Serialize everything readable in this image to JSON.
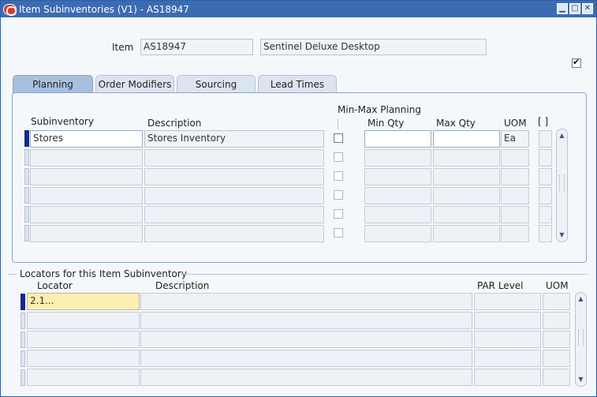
{
  "window": {
    "title": "Item Subinventories (V1) - AS18947",
    "buttons": [
      "minimize-icon",
      "maximize-icon",
      "close-icon"
    ]
  },
  "item": {
    "label": "Item",
    "value": "AS18947",
    "description": "Sentinel Deluxe Desktop",
    "checkbox_checked": true
  },
  "tabs": [
    {
      "label": "Planning",
      "active": true
    },
    {
      "label": "Order Modifiers",
      "active": false
    },
    {
      "label": "Sourcing",
      "active": false
    },
    {
      "label": "Lead Times",
      "active": false
    }
  ],
  "planning": {
    "headers": {
      "subinventory": "Subinventory",
      "description": "Description",
      "minmax_group": "Min-Max Planning",
      "min_qty": "Min Qty",
      "max_qty": "Max Qty",
      "uom": "UOM",
      "flex": "[ ]"
    },
    "rows": [
      {
        "subinventory": "Stores",
        "description": "Stores Inventory",
        "minmax": false,
        "min_qty": "",
        "max_qty": "",
        "uom": "Ea"
      },
      {
        "subinventory": "",
        "description": "",
        "minmax": false,
        "min_qty": "",
        "max_qty": "",
        "uom": ""
      },
      {
        "subinventory": "",
        "description": "",
        "minmax": false,
        "min_qty": "",
        "max_qty": "",
        "uom": ""
      },
      {
        "subinventory": "",
        "description": "",
        "minmax": false,
        "min_qty": "",
        "max_qty": "",
        "uom": ""
      },
      {
        "subinventory": "",
        "description": "",
        "minmax": false,
        "min_qty": "",
        "max_qty": "",
        "uom": ""
      },
      {
        "subinventory": "",
        "description": "",
        "minmax": false,
        "min_qty": "",
        "max_qty": "",
        "uom": ""
      }
    ]
  },
  "locators": {
    "section_title": "Locators for this Item Subinventory",
    "headers": {
      "locator": "Locator",
      "description": "Description",
      "par_level": "PAR Level",
      "uom": "UOM"
    },
    "rows": [
      {
        "locator": "2.1...",
        "description": "",
        "par_level": "",
        "uom": ""
      },
      {
        "locator": "",
        "description": "",
        "par_level": "",
        "uom": ""
      },
      {
        "locator": "",
        "description": "",
        "par_level": "",
        "uom": ""
      },
      {
        "locator": "",
        "description": "",
        "par_level": "",
        "uom": ""
      },
      {
        "locator": "",
        "description": "",
        "par_level": "",
        "uom": ""
      }
    ]
  },
  "colors": {
    "titlebar": "#3c6bb4",
    "active_tab": "#a7c0de",
    "current_row_indicator": "#102a8c",
    "focused_field": "#fdeeb2"
  }
}
